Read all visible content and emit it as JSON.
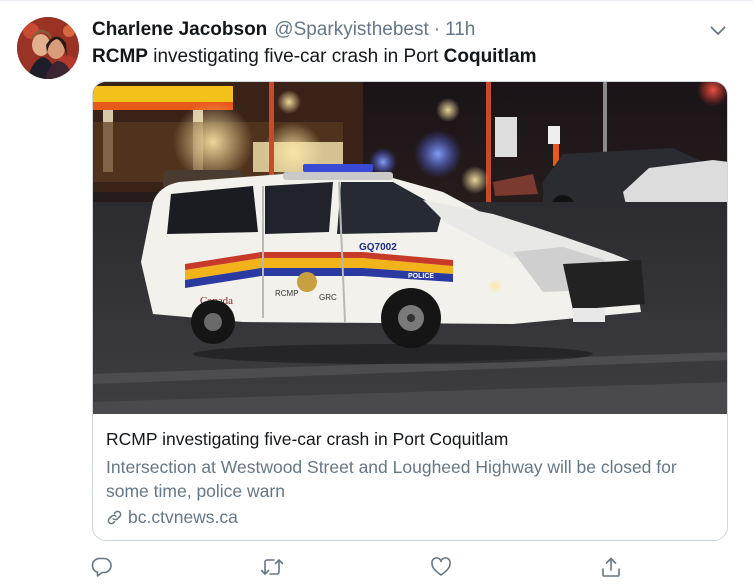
{
  "tweet": {
    "display_name": "Charlene Jacobson",
    "handle": "@Sparkyisthebest",
    "separator": "·",
    "timestamp": "11h",
    "text_part_1": "RCMP",
    "text_part_2": " investigating five-car crash in Port ",
    "text_part_3": "Coquitlam"
  },
  "card": {
    "image_icon": "police-car-crash-photo",
    "car_door_text": "Canada",
    "car_rcmp_text": "RCMP",
    "car_grc_text": "GRC",
    "car_unit_number": "GQ7002",
    "car_police_text": "POLICE",
    "title": "RCMP investigating five-car crash in Port Coquitlam",
    "description": "Intersection at Westwood Street and Lougheed Highway will be closed for some time, police warn",
    "domain": "bc.ctvnews.ca"
  },
  "icons": {
    "caret": "chevron-down-icon",
    "link": "link-icon",
    "reply": "reply-icon",
    "retweet": "retweet-icon",
    "like": "heart-icon",
    "share": "share-icon"
  },
  "colors": {
    "text_primary": "#14171a",
    "text_secondary": "#657786",
    "border": "#ccd6dd",
    "icon": "#657786"
  }
}
